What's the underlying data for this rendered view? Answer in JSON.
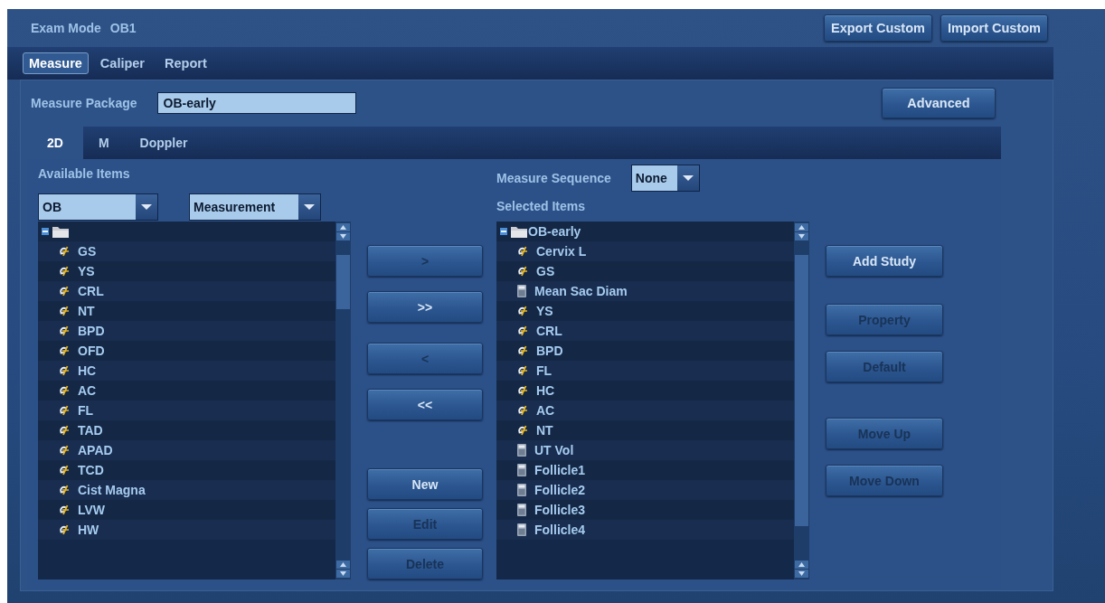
{
  "header": {
    "exam_mode_label": "Exam Mode",
    "exam_mode_value": "OB1",
    "buttons": [
      {
        "label": "Export Custom"
      },
      {
        "label": "Import Custom"
      }
    ]
  },
  "tabs": [
    {
      "label": "Measure",
      "selected": true
    },
    {
      "label": "Caliper",
      "selected": false
    },
    {
      "label": "Report",
      "selected": false
    }
  ],
  "measure_package": {
    "label": "Measure Package",
    "value": "OB-early"
  },
  "advanced_button": {
    "label": "Advanced"
  },
  "mode_tabs": [
    {
      "label": "2D",
      "selected": true
    },
    {
      "label": "M",
      "selected": false
    },
    {
      "label": "Doppler",
      "selected": false
    }
  ],
  "available": {
    "title": "Available Items",
    "filters": [
      {
        "value": "OB"
      },
      {
        "value": "Measurement"
      }
    ],
    "tree": [
      {
        "expanded": true,
        "children": [
          {
            "label": "GS",
            "kind": "measure"
          },
          {
            "label": "YS",
            "kind": "measure"
          },
          {
            "label": "CRL",
            "kind": "measure"
          },
          {
            "label": "NT",
            "kind": "measure"
          },
          {
            "label": "BPD",
            "kind": "measure"
          },
          {
            "label": "OFD",
            "kind": "measure"
          },
          {
            "label": "HC",
            "kind": "measure"
          },
          {
            "label": "AC",
            "kind": "measure"
          },
          {
            "label": "FL",
            "kind": "measure"
          },
          {
            "label": "TAD",
            "kind": "measure"
          },
          {
            "label": "APAD",
            "kind": "measure"
          },
          {
            "label": "TCD",
            "kind": "measure"
          },
          {
            "label": "Cist Magna",
            "kind": "measure"
          },
          {
            "label": "LVW",
            "kind": "measure"
          },
          {
            "label": "HW",
            "kind": "measure"
          }
        ]
      }
    ]
  },
  "transfer_buttons": [
    {
      "label": ">",
      "disabled": true
    },
    {
      "label": ">>",
      "disabled": false
    },
    {
      "label": "<",
      "disabled": true
    },
    {
      "label": "<<",
      "disabled": false
    },
    {
      "label": "New",
      "disabled": false
    },
    {
      "label": "Edit",
      "disabled": true
    },
    {
      "label": "Delete",
      "disabled": true
    }
  ],
  "selected": {
    "sequence_label": "Measure Sequence",
    "sequence_value": "None",
    "title": "Selected Items",
    "tree": [
      {
        "label": "OB-early",
        "expanded": true,
        "children": [
          {
            "label": "Cervix L",
            "kind": "measure"
          },
          {
            "label": "GS",
            "kind": "measure"
          },
          {
            "label": "Mean Sac Diam",
            "kind": "calc"
          },
          {
            "label": "YS",
            "kind": "measure"
          },
          {
            "label": "CRL",
            "kind": "measure"
          },
          {
            "label": "BPD",
            "kind": "measure"
          },
          {
            "label": "FL",
            "kind": "measure"
          },
          {
            "label": "HC",
            "kind": "measure"
          },
          {
            "label": "AC",
            "kind": "measure"
          },
          {
            "label": "NT",
            "kind": "measure"
          },
          {
            "label": "UT Vol",
            "kind": "calc"
          },
          {
            "label": "Follicle1",
            "kind": "calc"
          },
          {
            "label": "Follicle2",
            "kind": "calc"
          },
          {
            "label": "Follicle3",
            "kind": "calc"
          },
          {
            "label": "Follicle4",
            "kind": "calc"
          }
        ]
      }
    ]
  },
  "side_buttons": [
    {
      "label": "Add Study",
      "disabled": false
    },
    {
      "label": "Property",
      "disabled": true
    },
    {
      "label": "Default",
      "disabled": true
    },
    {
      "label": "Move Up",
      "disabled": true
    },
    {
      "label": "Move Down",
      "disabled": true
    }
  ]
}
